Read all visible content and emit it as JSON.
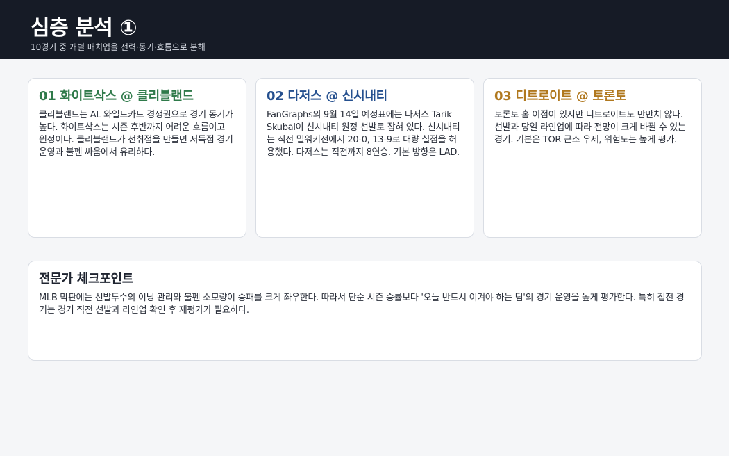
{
  "header": {
    "title": "심층 분석 ①",
    "subtitle": "10경기 중 개별 매치업을 전력·동기·흐름으로 분해"
  },
  "games": [
    {
      "num": "01",
      "matchup": "화이트삭스 @ 클리블랜드",
      "color": "#2f7a4a",
      "body": "클리블랜드는 AL 와일드카드 경쟁권으로 경기 동기가 높다. 화이트삭스는 시즌 후반까지 어려운 흐름이고 원정이다. 클리블랜드가 선취점을 만들면 저득점 경기 운영과 불펜 싸움에서 유리하다."
    },
    {
      "num": "02",
      "matchup": "다저스 @ 신시내티",
      "color": "#25508f",
      "body": "FanGraphs의 9월 14일 예정표에는 다저스 Tarik Skubal이 신시내티 원정 선발로 잡혀 있다. 신시내티는 직전 밀워키전에서 20-0, 13-9로 대량 실점을 허용했다. 다저스는 직전까지 8연승. 기본 방향은 LAD."
    },
    {
      "num": "03",
      "matchup": "디트로이트 @ 토론토",
      "color": "#b0781e",
      "body": "토론토 홈 이점이 있지만 디트로이트도 만만치 않다. 선발과 당일 라인업에 따라 전망이 크게 바뀔 수 있는 경기. 기본은 TOR 근소 우세, 위험도는 높게 평가."
    }
  ],
  "expert": {
    "title": "전문가 체크포인트",
    "body": "MLB 막판에는 선발투수의 이닝 관리와 불펜 소모량이 승패를 크게 좌우한다. 따라서 단순 시즌 승률보다 '오늘 반드시 이겨야 하는 팀'의 경기 운영을 높게 평가한다. 특히 접전 경기는 경기 직전 선발과 라인업 확인 후 재평가가 필요하다."
  }
}
